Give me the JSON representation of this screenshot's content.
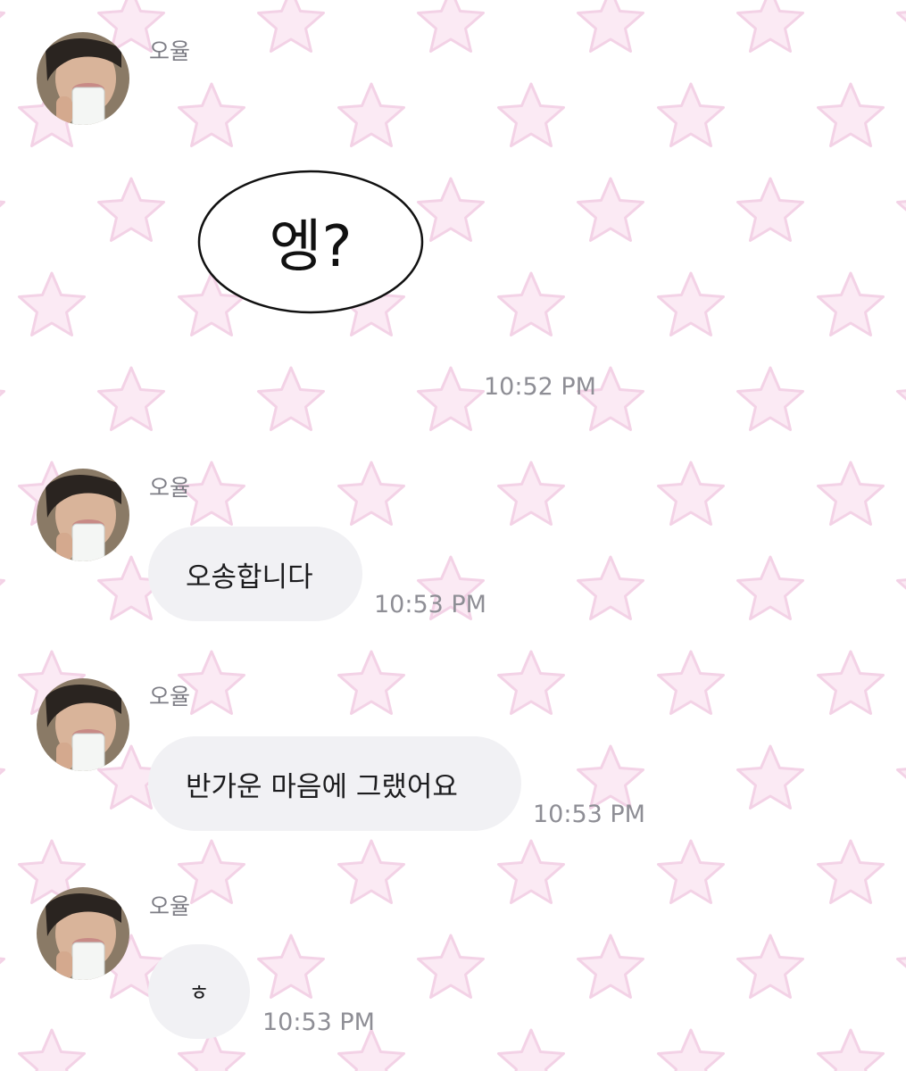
{
  "theme": {
    "background": "#ffffff",
    "star_fill": "#fbeaf4",
    "star_stroke": "#f3d2e6",
    "bubble_color": "#f1f1f4"
  },
  "messages": [
    {
      "sender": "오율",
      "type": "sticker",
      "sticker_text": "엥?",
      "time": "10:52 PM"
    },
    {
      "sender": "오율",
      "type": "text",
      "text": "오송합니다",
      "time": "10:53 PM"
    },
    {
      "sender": "오율",
      "type": "text",
      "text": "반가운 마음에 그랬어요",
      "time": "10:53 PM"
    },
    {
      "sender": "오율",
      "type": "text",
      "text": "ㅎ",
      "time": "10:53 PM"
    }
  ]
}
